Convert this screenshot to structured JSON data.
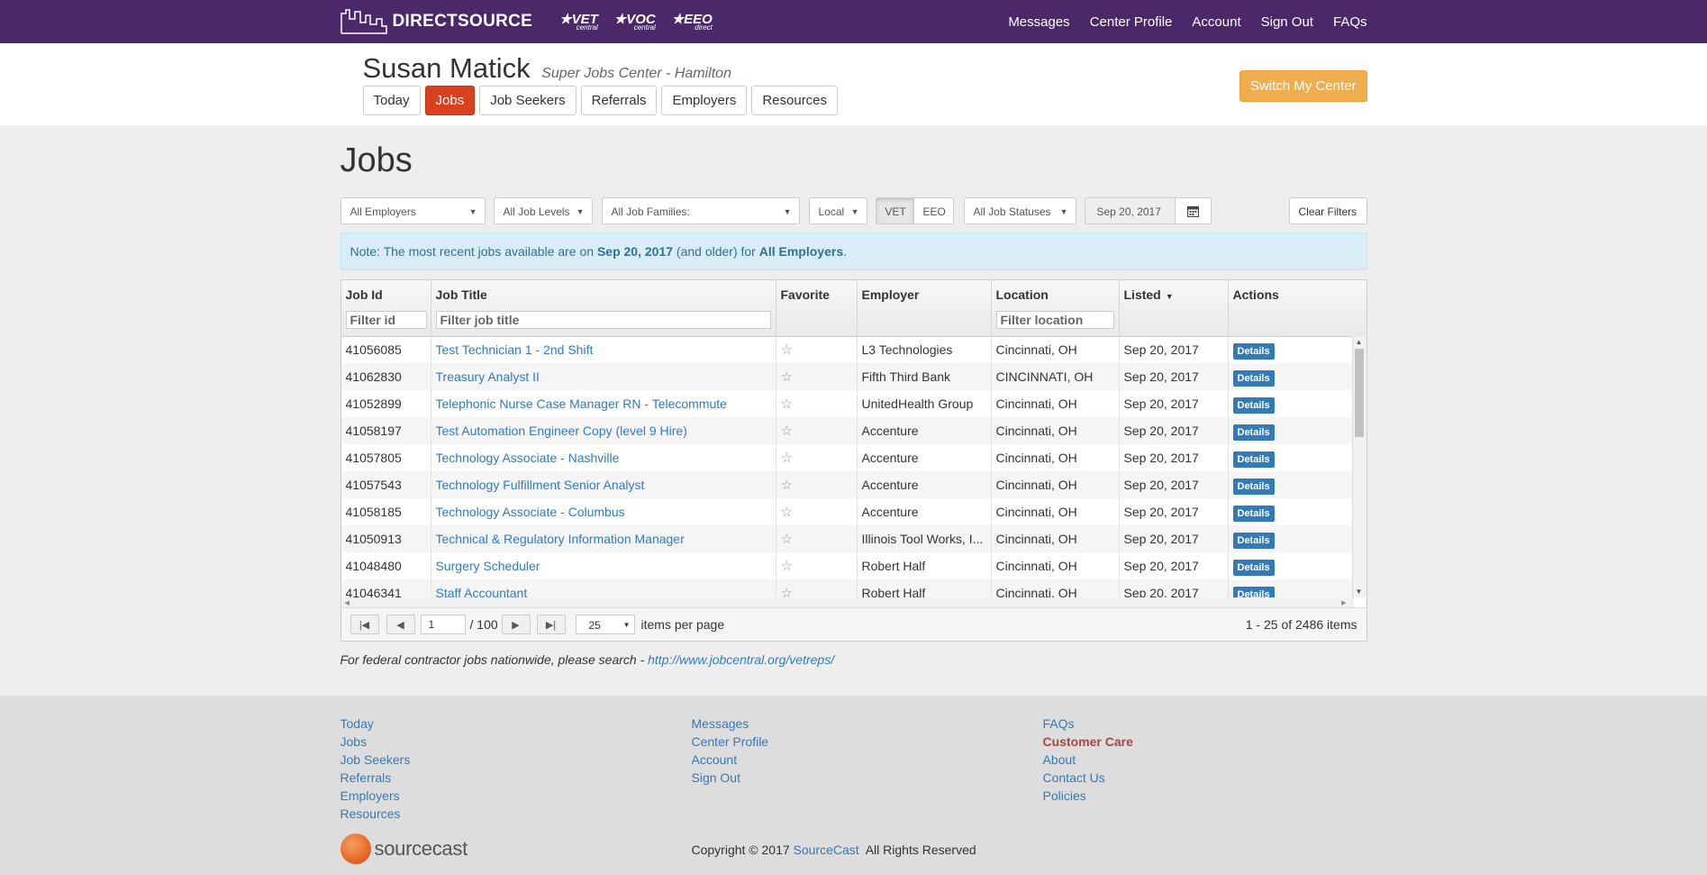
{
  "topbar": {
    "logo_text": "DIRECTSOURCE",
    "brands": [
      {
        "name": "VET",
        "sub": "central"
      },
      {
        "name": "VOC",
        "sub": "central"
      },
      {
        "name": "EEO",
        "sub": "direct"
      }
    ],
    "nav": [
      "Messages",
      "Center Profile",
      "Account",
      "Sign Out",
      "FAQs"
    ],
    "bg_color": "#4b2869"
  },
  "header": {
    "user_name": "Susan Matick",
    "center_name": "Super Jobs Center - Hamilton",
    "tabs": [
      "Today",
      "Jobs",
      "Job Seekers",
      "Referrals",
      "Employers",
      "Resources"
    ],
    "active_tab": "Jobs",
    "switch_button": "Switch My Center"
  },
  "page": {
    "title": "Jobs",
    "filters": {
      "employers": "All Employers",
      "job_levels": "All Job Levels",
      "job_families": "All Job Families:",
      "scope": "Local",
      "vet": "VET",
      "eeo": "EEO",
      "job_statuses": "All Job Statuses",
      "date": "Sep 20, 2017",
      "clear": "Clear Filters"
    },
    "note": {
      "prefix": "Note: The most recent jobs available are on ",
      "date": "Sep 20, 2017",
      "middle": " (and older) for ",
      "employers": "All Employers",
      "suffix": "."
    }
  },
  "grid": {
    "columns": {
      "job_id": "Job Id",
      "job_title": "Job Title",
      "favorite": "Favorite",
      "employer": "Employer",
      "location": "Location",
      "listed": "Listed",
      "actions": "Actions"
    },
    "filters": {
      "id_placeholder": "Filter id",
      "title_placeholder": "Filter job title",
      "location_placeholder": "Filter location"
    },
    "rows": [
      {
        "id": "41056085",
        "title": "Test Technician 1 - 2nd Shift",
        "employer": "L3 Technologies",
        "location": "Cincinnati, OH",
        "listed": "Sep 20, 2017",
        "action": "Details"
      },
      {
        "id": "41062830",
        "title": "Treasury Analyst II",
        "employer": "Fifth Third Bank",
        "location": "CINCINNATI, OH",
        "listed": "Sep 20, 2017",
        "action": "Details"
      },
      {
        "id": "41052899",
        "title": "Telephonic Nurse Case Manager RN - Telecommute",
        "employer": "UnitedHealth Group",
        "location": "Cincinnati, OH",
        "listed": "Sep 20, 2017",
        "action": "Details"
      },
      {
        "id": "41058197",
        "title": "Test Automation Engineer Copy (level 9 Hire)",
        "employer": "Accenture",
        "location": "Cincinnati, OH",
        "listed": "Sep 20, 2017",
        "action": "Details"
      },
      {
        "id": "41057805",
        "title": "Technology Associate - Nashville",
        "employer": "Accenture",
        "location": "Cincinnati, OH",
        "listed": "Sep 20, 2017",
        "action": "Details"
      },
      {
        "id": "41057543",
        "title": "Technology Fulfillment Senior Analyst",
        "employer": "Accenture",
        "location": "Cincinnati, OH",
        "listed": "Sep 20, 2017",
        "action": "Details"
      },
      {
        "id": "41058185",
        "title": "Technology Associate - Columbus",
        "employer": "Accenture",
        "location": "Cincinnati, OH",
        "listed": "Sep 20, 2017",
        "action": "Details"
      },
      {
        "id": "41050913",
        "title": "Technical & Regulatory Information Manager",
        "employer": "Illinois Tool Works, I...",
        "location": "Cincinnati, OH",
        "listed": "Sep 20, 2017",
        "action": "Details"
      },
      {
        "id": "41048480",
        "title": "Surgery Scheduler",
        "employer": "Robert Half",
        "location": "Cincinnati, OH",
        "listed": "Sep 20, 2017",
        "action": "Details"
      },
      {
        "id": "41046341",
        "title": "Staff Accountant",
        "employer": "Robert Half",
        "location": "Cincinnati, OH",
        "listed": "Sep 20, 2017",
        "action": "Details"
      }
    ],
    "pager": {
      "page": "1",
      "of_pages": "/ 100",
      "page_size": "25",
      "page_size_label": "items per page",
      "summary": "1 - 25 of 2486 items"
    }
  },
  "federal": {
    "text": "For federal contractor jobs nationwide, please search - ",
    "link": "http://www.jobcentral.org/vetreps/"
  },
  "footer": {
    "col1": [
      "Today",
      "Jobs",
      "Job Seekers",
      "Referrals",
      "Employers",
      "Resources"
    ],
    "col2": [
      "Messages",
      "Center Profile",
      "Account",
      "Sign Out"
    ],
    "col3": [
      "FAQs",
      "Customer Care",
      "About",
      "Contact Us",
      "Policies"
    ],
    "logo_text": "sourcecast",
    "copyright_prefix": "Copyright © 2017 ",
    "copyright_link": "SourceCast",
    "copyright_suffix": "  All Rights Reserved"
  }
}
